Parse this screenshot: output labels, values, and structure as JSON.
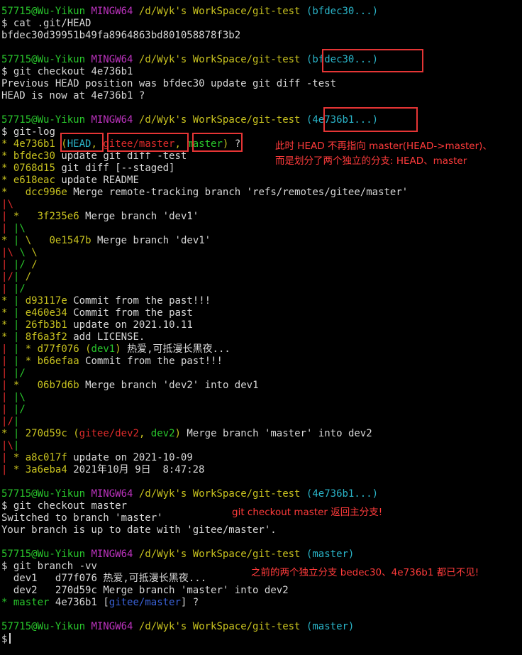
{
  "prompt": {
    "user": "57715@Wu-Yikun",
    "host": "MINGW64",
    "path": "/d/Wyk's WorkSpace/git-test",
    "dollar": "$"
  },
  "branch_labels": [
    "(bfdec30...)",
    "(bfdec30...)",
    "(4e736b1...)",
    "(4e736b1...)",
    "(master)",
    "(master)"
  ],
  "commands": [
    "cat .git/HEAD",
    "git checkout 4e736b1",
    "git-log",
    "git checkout master",
    "git branch -vv"
  ],
  "output": {
    "head_hash": "bfdec30d39951b49fa8964863bd801058878f3b2",
    "checkout1": [
      "Previous HEAD position was bfdec30 update git diff -test",
      "HEAD is now at 4e736b1 ?"
    ],
    "checkout2": [
      "Switched to branch 'master'",
      "Your branch is up to date with 'gitee/master'."
    ]
  },
  "log": {
    "first": {
      "graph": "* ",
      "hash": "4e736b1",
      "refs": [
        "HEAD",
        "gitee/master",
        "master"
      ],
      "msg": "?"
    },
    "rows": [
      {
        "graph": "* ",
        "hash": "bfdec30",
        "msg": "update git diff -test"
      },
      {
        "graph": "* ",
        "hash": "0768d15",
        "msg": "git diff [--staged]"
      },
      {
        "graph": "* ",
        "hash": "e618eac",
        "msg": "update README"
      },
      {
        "graph": "*   ",
        "hash": "dcc996e",
        "msg": "Merge remote-tracking branch 'refs/remotes/gitee/master'"
      },
      {
        "graph": "|\\",
        "hash": "",
        "msg": ""
      },
      {
        "graph": "| *   ",
        "hash": "3f235e6",
        "msg": "Merge branch 'dev1'"
      },
      {
        "graph": "| |\\",
        "hash": "",
        "msg": ""
      },
      {
        "graph": "* | \\   ",
        "hash": "0e1547b",
        "msg": "Merge branch 'dev1'"
      },
      {
        "graph": "|\\ \\ \\",
        "hash": "",
        "msg": ""
      },
      {
        "graph": "| |/ /",
        "hash": "",
        "msg": ""
      },
      {
        "graph": "|/| /",
        "hash": "",
        "msg": ""
      },
      {
        "graph": "| |/",
        "hash": "",
        "msg": ""
      },
      {
        "graph": "* | ",
        "hash": "d93117e",
        "msg": "Commit from the past!!!"
      },
      {
        "graph": "* | ",
        "hash": "e460e34",
        "msg": "Commit from the past"
      },
      {
        "graph": "* | ",
        "hash": "26fb3b1",
        "msg": "update on 2021.10.11"
      },
      {
        "graph": "* | ",
        "hash": "8f6a3f2",
        "msg": "add LICENSE."
      },
      {
        "graph": "| | * ",
        "hash": "d77f076",
        "refs": [
          "dev1"
        ],
        "msg": "热爱,可抵漫长黑夜..."
      },
      {
        "graph": "| | * ",
        "hash": "b66efaa",
        "msg": "Commit from the past!!!"
      },
      {
        "graph": "| |/",
        "hash": "",
        "msg": ""
      },
      {
        "graph": "| *   ",
        "hash": "06b7d6b",
        "msg": "Merge branch 'dev2' into dev1"
      },
      {
        "graph": "| |\\",
        "hash": "",
        "msg": ""
      },
      {
        "graph": "| |/",
        "hash": "",
        "msg": ""
      },
      {
        "graph": "|/|",
        "hash": "",
        "msg": ""
      },
      {
        "graph": "* | ",
        "hash": "270d59c",
        "refs": [
          "gitee/dev2",
          "dev2"
        ],
        "msg": "Merge branch 'master' into dev2"
      },
      {
        "graph": "|\\|",
        "hash": "",
        "msg": ""
      },
      {
        "graph": "| * ",
        "hash": "a8c017f",
        "msg": "update on 2021-10-09"
      },
      {
        "graph": "| * ",
        "hash": "3a6eba4",
        "msg": "2021年10月 9日  8:47:28"
      }
    ]
  },
  "branches": [
    {
      "marker": " ",
      "name": "dev1",
      "hash": "d77f076",
      "msg": "热爱,可抵漫长黑夜..."
    },
    {
      "marker": " ",
      "name": "dev2",
      "hash": "270d59c",
      "msg": "Merge branch 'master' into dev2"
    },
    {
      "marker": "*",
      "name": "master",
      "hash": "4e736b1",
      "upstream": "gitee/master",
      "msg": "?"
    }
  ],
  "annotations": {
    "note1_line1": "此时 HEAD 不再指向 master(HEAD->master)、",
    "note1_line2": "而是划分了两个独立的分支: HEAD、master",
    "note2": "git checkout master 返回主分支!",
    "note3": "之前的两个独立分支 bedec30、4e736b1 都已不见!"
  },
  "colors": {
    "green": "#29c72c",
    "magenta": "#bd33bf",
    "yellow": "#c8c21f",
    "cyan": "#2ab4c8",
    "red": "#dd2b2b",
    "blue": "#3a62d8",
    "annotation": "#ff3b3b"
  }
}
